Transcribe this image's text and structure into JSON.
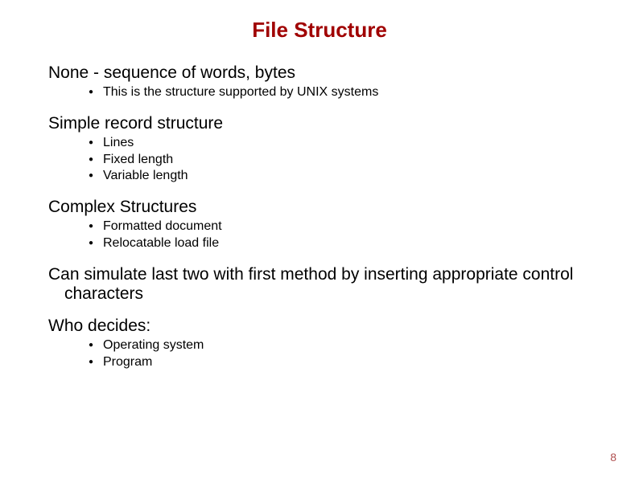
{
  "title": "File Structure",
  "sections": [
    {
      "heading": "None - sequence of words, bytes",
      "bullets": [
        "This is the structure supported  by UNIX systems"
      ]
    },
    {
      "heading": "Simple record structure",
      "bullets": [
        "Lines",
        "Fixed length",
        "Variable length"
      ]
    },
    {
      "heading": "Complex Structures",
      "bullets": [
        "Formatted document",
        "Relocatable load file"
      ]
    },
    {
      "heading": "Can simulate last two with first method by inserting appropriate control characters",
      "bullets": []
    },
    {
      "heading": "Who decides:",
      "bullets": [
        "Operating system",
        "Program"
      ]
    }
  ],
  "page_number": "8"
}
